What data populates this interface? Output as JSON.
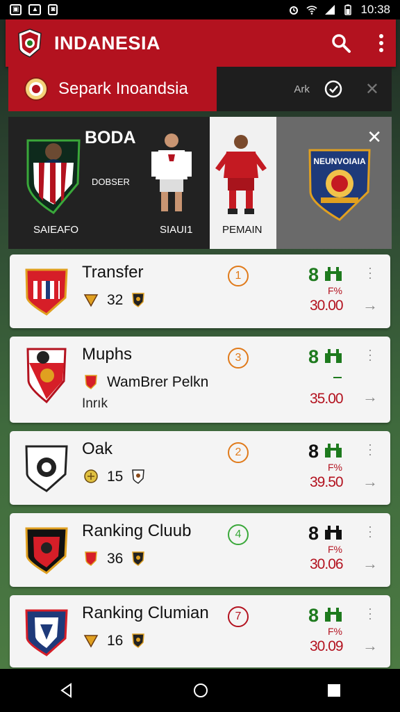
{
  "status_bar": {
    "left_icons": [
      "sim-icon",
      "image-icon",
      "screenshot-icon"
    ],
    "right_icons": [
      "alarm-icon",
      "wifi-icon",
      "signal-icon",
      "battery-icon"
    ],
    "time": "10:38"
  },
  "app_bar": {
    "title": "INDANESIA",
    "actions": [
      "search-icon",
      "more-vert-icon"
    ],
    "accent": "#b3121f"
  },
  "sub_header": {
    "title": "Separk Inoandsia",
    "right_text": "Ark"
  },
  "featured": {
    "title": "BODA",
    "subtitle": "DOBSER",
    "label_left": "SAIEAFO",
    "label_mid": "SIAUI1",
    "label_right": "PEMAIN",
    "crest_text": "NEUNVOIAIA"
  },
  "cards": [
    {
      "name": "Transfer",
      "stat": "32",
      "extra": "",
      "extra_sub": "",
      "rank": "1",
      "rank_color": "#e07a1a",
      "score": "8",
      "score_color": "#1e7a1e",
      "pct": "F%",
      "price": "30.00"
    },
    {
      "name": "Muphs",
      "stat": "",
      "extra": "Inrık",
      "extra_sub": "WamBrer Pelkn",
      "rank": "3",
      "rank_color": "#e07a1a",
      "score": "8",
      "score_color": "#1e7a1e",
      "pct": "",
      "price": "35.00"
    },
    {
      "name": "Oak",
      "stat": "15",
      "extra": "",
      "extra_sub": "",
      "rank": "2",
      "rank_color": "#e07a1a",
      "score": "8",
      "score_color": "#111111",
      "pct": "F%",
      "price": "39.50"
    },
    {
      "name": "Ranking Cluub",
      "stat": "36",
      "extra": "",
      "extra_sub": "",
      "rank": "4",
      "rank_color": "#3aa83a",
      "score": "8",
      "score_color": "#111111",
      "pct": "F%",
      "price": "30.06"
    },
    {
      "name": "Ranking Clumian",
      "stat": "16",
      "extra": "",
      "extra_sub": "",
      "rank": "7",
      "rank_color": "#b3121f",
      "score": "8",
      "score_color": "#1e7a1e",
      "pct": "F%",
      "price": "30.09"
    }
  ],
  "nav_bar": {
    "buttons": [
      "back-icon",
      "home-icon",
      "recents-icon"
    ]
  }
}
